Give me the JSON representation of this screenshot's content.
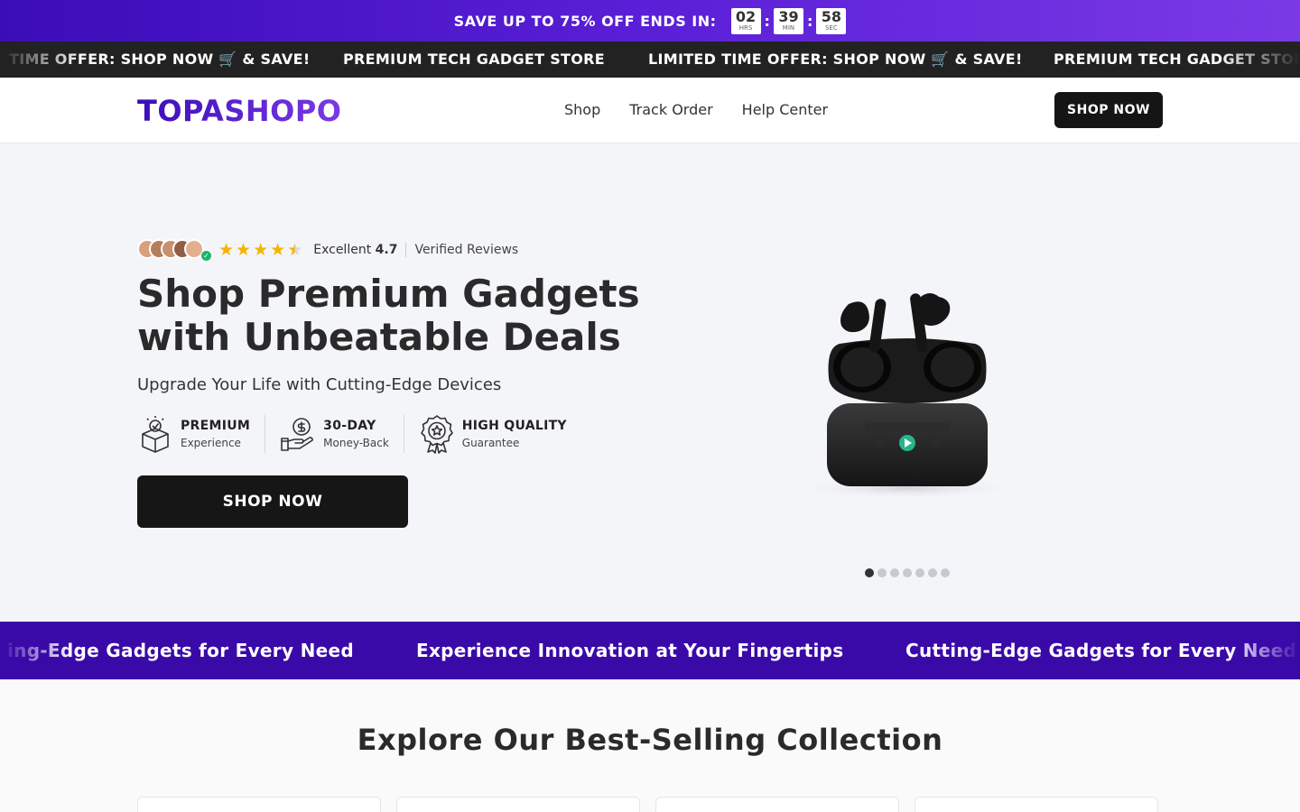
{
  "promo": {
    "text": "SAVE UP TO 75% OFF ENDS IN:",
    "hours": "02",
    "hours_label": "HRS",
    "minutes": "39",
    "minutes_label": "MIN",
    "seconds": "58",
    "seconds_label": "SEC",
    "separator": ":"
  },
  "ticker": {
    "items": [
      "TIME OFFER: SHOP NOW 🛒 & SAVE!",
      "PREMIUM TECH GADGET STORE",
      "LIMITED TIME OFFER: SHOP NOW 🛒 & SAVE!",
      "PREMIUM TECH GADGET STORE"
    ]
  },
  "header": {
    "logo": "TOPASHOPO",
    "nav": [
      "Shop",
      "Track Order",
      "Help Center"
    ],
    "cta": "SHOP NOW"
  },
  "hero": {
    "rating_label": "Excellent",
    "rating_value": "4.7",
    "reviews": "Verified Reviews",
    "stars": 4.5,
    "title": "Shop Premium Gadgets with Unbeatable Deals",
    "subtitle": "Upgrade Your Life with Cutting-Edge Devices",
    "features": [
      {
        "title": "PREMIUM",
        "desc": "Experience",
        "icon": "gift-box-icon"
      },
      {
        "title": "30-DAY",
        "desc": "Money-Back",
        "icon": "money-hand-icon"
      },
      {
        "title": "HIGH QUALITY",
        "desc": "Guarantee",
        "icon": "quality-badge-icon"
      }
    ],
    "cta": "SHOP NOW",
    "slides": 7,
    "active_slide": 1
  },
  "band": {
    "items": [
      "ing-Edge Gadgets for Every Need",
      "Experience Innovation at Your Fingertips",
      "Cutting-Edge Gadgets for Every Need"
    ]
  },
  "collection": {
    "title": "Explore Our Best-Selling Collection"
  },
  "colors": {
    "brand_purple": "#3b0db8",
    "brand_violet": "#7b3ae6",
    "star": "#f4b400",
    "verified": "#1bb46a",
    "button_dark": "#161616"
  }
}
